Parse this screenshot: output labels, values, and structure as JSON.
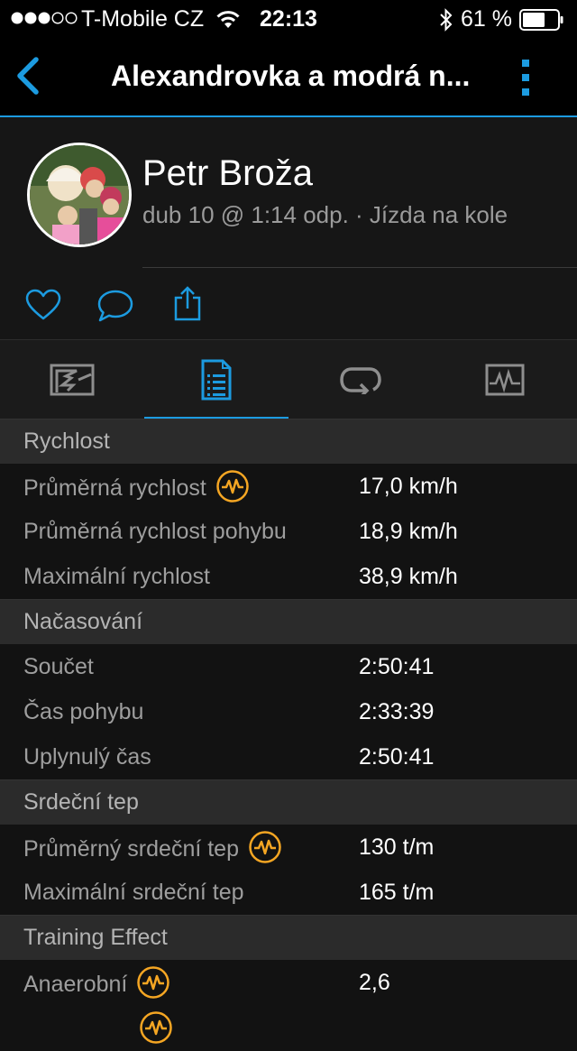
{
  "status_bar": {
    "carrier": "T-Mobile CZ",
    "time": "22:13",
    "battery": "61 %",
    "signal_icon": "signal-dots-icon",
    "wifi_icon": "wifi-icon",
    "bluetooth_icon": "bluetooth-icon",
    "battery_icon": "battery-icon"
  },
  "nav": {
    "title": "Alexandrovka a modrá n...",
    "back_icon": "chevron-left-icon",
    "more_icon": "vertical-dots-icon"
  },
  "profile": {
    "name": "Petr Broža",
    "meta": "dub 10 @ 1:14 odp. · Jízda na kole",
    "avatar_icon": "avatar-photo"
  },
  "actions": {
    "like_icon": "heart-icon",
    "comment_icon": "comment-bubble-icon",
    "share_icon": "share-icon"
  },
  "tabs": [
    {
      "icon": "map-icon"
    },
    {
      "icon": "stats-list-icon"
    },
    {
      "icon": "laps-icon"
    },
    {
      "icon": "charts-icon"
    }
  ],
  "colors": {
    "accent": "#1c9be0",
    "badge": "#f5a623"
  },
  "stats": {
    "speed": {
      "header": "Rychlost",
      "rows": [
        {
          "label": "Průměrná rychlost",
          "value": "17,0 km/h"
        },
        {
          "label": "Průměrná rychlost pohybu",
          "value": "18,9 km/h"
        },
        {
          "label": "Maximální rychlost",
          "value": "38,9 km/h"
        }
      ]
    },
    "timing": {
      "header": "Načasování",
      "rows": [
        {
          "label": "Součet",
          "value": "2:50:41"
        },
        {
          "label": "Čas pohybu",
          "value": "2:33:39"
        },
        {
          "label": "Uplynulý čas",
          "value": "2:50:41"
        }
      ]
    },
    "heart": {
      "header": "Srdeční tep",
      "rows": [
        {
          "label": "Průměrný srdeční tep",
          "value": "130 t/m"
        },
        {
          "label": "Maximální srdeční tep",
          "value": "165 t/m"
        }
      ]
    },
    "training": {
      "header": "Training Effect",
      "rows": [
        {
          "label": "Anaerobní",
          "value": "2,6"
        }
      ]
    }
  }
}
